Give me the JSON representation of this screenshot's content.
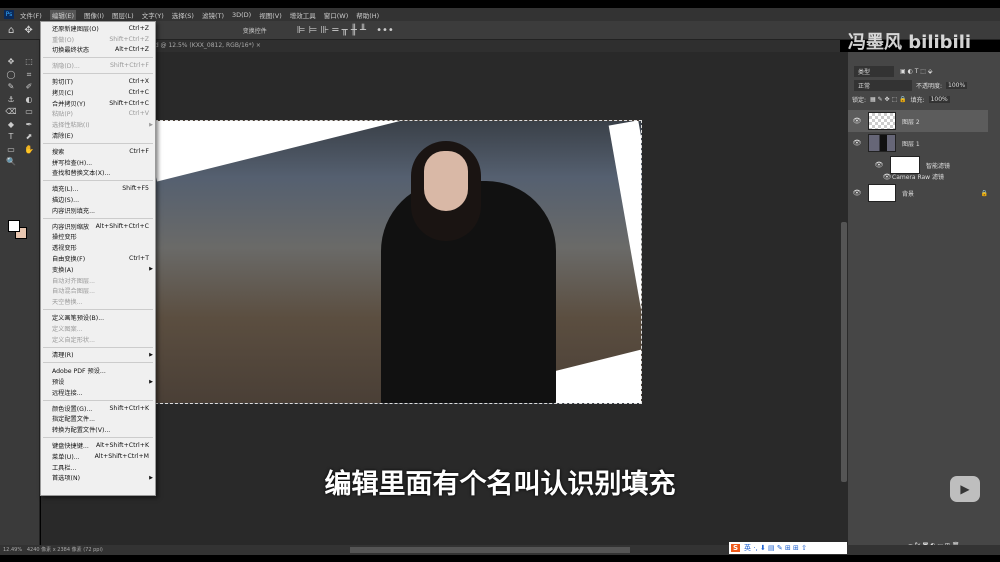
{
  "menubar": {
    "app_icon": "Ps",
    "items": [
      "文件(F)",
      "编辑(E)",
      "图像(I)",
      "图层(L)",
      "文字(Y)",
      "选择(S)",
      "滤镜(T)",
      "3D(D)",
      "视图(V)",
      "增效工具",
      "窗口(W)",
      "帮助(H)"
    ],
    "active_index": 1
  },
  "options_bar": {
    "home_icon": "home-icon",
    "move_icon": "move-icon",
    "transform_label": "变换控件",
    "more_label": "•••"
  },
  "document_tab": {
    "title": "-1.psd @ 12.5% (KXX_0812, RGB/16*)",
    "close": "×"
  },
  "edit_menu": {
    "groups": [
      [
        {
          "label": "还原新建图层(O)",
          "shortcut": "Ctrl+Z"
        },
        {
          "label": "重做(O)",
          "shortcut": "Shift+Ctrl+Z",
          "disabled": true
        },
        {
          "label": "切换最终状态",
          "shortcut": "Alt+Ctrl+Z"
        }
      ],
      [
        {
          "label": "渐隐(D)...",
          "shortcut": "Shift+Ctrl+F",
          "disabled": true
        }
      ],
      [
        {
          "label": "剪切(T)",
          "shortcut": "Ctrl+X"
        },
        {
          "label": "拷贝(C)",
          "shortcut": "Ctrl+C"
        },
        {
          "label": "合并拷贝(Y)",
          "shortcut": "Shift+Ctrl+C"
        },
        {
          "label": "粘贴(P)",
          "shortcut": "Ctrl+V",
          "disabled": true
        },
        {
          "label": "选择性粘贴(I)",
          "shortcut": "",
          "disabled": true,
          "submenu": true
        },
        {
          "label": "清除(E)",
          "shortcut": ""
        }
      ],
      [
        {
          "label": "搜索",
          "shortcut": "Ctrl+F"
        },
        {
          "label": "拼写检查(H)...",
          "shortcut": ""
        },
        {
          "label": "查找和替换文本(X)...",
          "shortcut": ""
        }
      ],
      [
        {
          "label": "填充(L)...",
          "shortcut": "Shift+F5"
        },
        {
          "label": "描边(S)...",
          "shortcut": ""
        },
        {
          "label": "内容识别填充...",
          "shortcut": ""
        }
      ],
      [
        {
          "label": "内容识别缩放",
          "shortcut": "Alt+Shift+Ctrl+C"
        },
        {
          "label": "操控变形",
          "shortcut": ""
        },
        {
          "label": "透视变形",
          "shortcut": ""
        },
        {
          "label": "自由变换(F)",
          "shortcut": "Ctrl+T"
        },
        {
          "label": "变换(A)",
          "shortcut": "",
          "submenu": true
        },
        {
          "label": "自动对齐图层...",
          "shortcut": "",
          "disabled": true
        },
        {
          "label": "自动混合图层...",
          "shortcut": "",
          "disabled": true
        },
        {
          "label": "天空替换...",
          "shortcut": "",
          "disabled": true
        }
      ],
      [
        {
          "label": "定义画笔预设(B)...",
          "shortcut": ""
        },
        {
          "label": "定义图案...",
          "shortcut": "",
          "disabled": true
        },
        {
          "label": "定义自定形状...",
          "shortcut": "",
          "disabled": true
        }
      ],
      [
        {
          "label": "清理(R)",
          "shortcut": "",
          "submenu": true
        }
      ],
      [
        {
          "label": "Adobe PDF 预设...",
          "shortcut": ""
        },
        {
          "label": "预设",
          "shortcut": "",
          "submenu": true
        },
        {
          "label": "远程连接...",
          "shortcut": ""
        }
      ],
      [
        {
          "label": "颜色设置(G)...",
          "shortcut": "Shift+Ctrl+K"
        },
        {
          "label": "指定配置文件...",
          "shortcut": ""
        },
        {
          "label": "转换为配置文件(V)...",
          "shortcut": ""
        }
      ],
      [
        {
          "label": "键盘快捷键...",
          "shortcut": "Alt+Shift+Ctrl+K"
        },
        {
          "label": "菜单(U)...",
          "shortcut": "Alt+Shift+Ctrl+M"
        },
        {
          "label": "工具栏...",
          "shortcut": ""
        },
        {
          "label": "首选项(N)",
          "shortcut": "",
          "submenu": true
        }
      ]
    ]
  },
  "layers_panel": {
    "filter_kind": "类型",
    "blend_mode": "正常",
    "opacity_label": "不透明度:",
    "opacity": "100%",
    "lock_label": "锁定:",
    "fill_label": "填充:",
    "fill": "100%",
    "layers": [
      {
        "name": "图层 2",
        "selected": true,
        "type": "transparent"
      },
      {
        "name": "图层 1",
        "type": "photo"
      },
      {
        "name": "智能滤镜",
        "type": "sublayer"
      },
      {
        "name": "Camera Raw 滤镜",
        "type": "filter"
      },
      {
        "name": "背景",
        "type": "background",
        "locked": true
      }
    ]
  },
  "subtitle": "编辑里面有个名叫认识别填充",
  "watermark": "冯墨风 bilibili",
  "status_bar": {
    "zoom": "12.49%",
    "doc_info": "4240 像素 x 2384 像素 (72 ppi)"
  },
  "colors": {
    "accent_ps": "#31a8ff",
    "menu_bg": "#f0f0f0",
    "ime_orange": "#f05a1a"
  }
}
